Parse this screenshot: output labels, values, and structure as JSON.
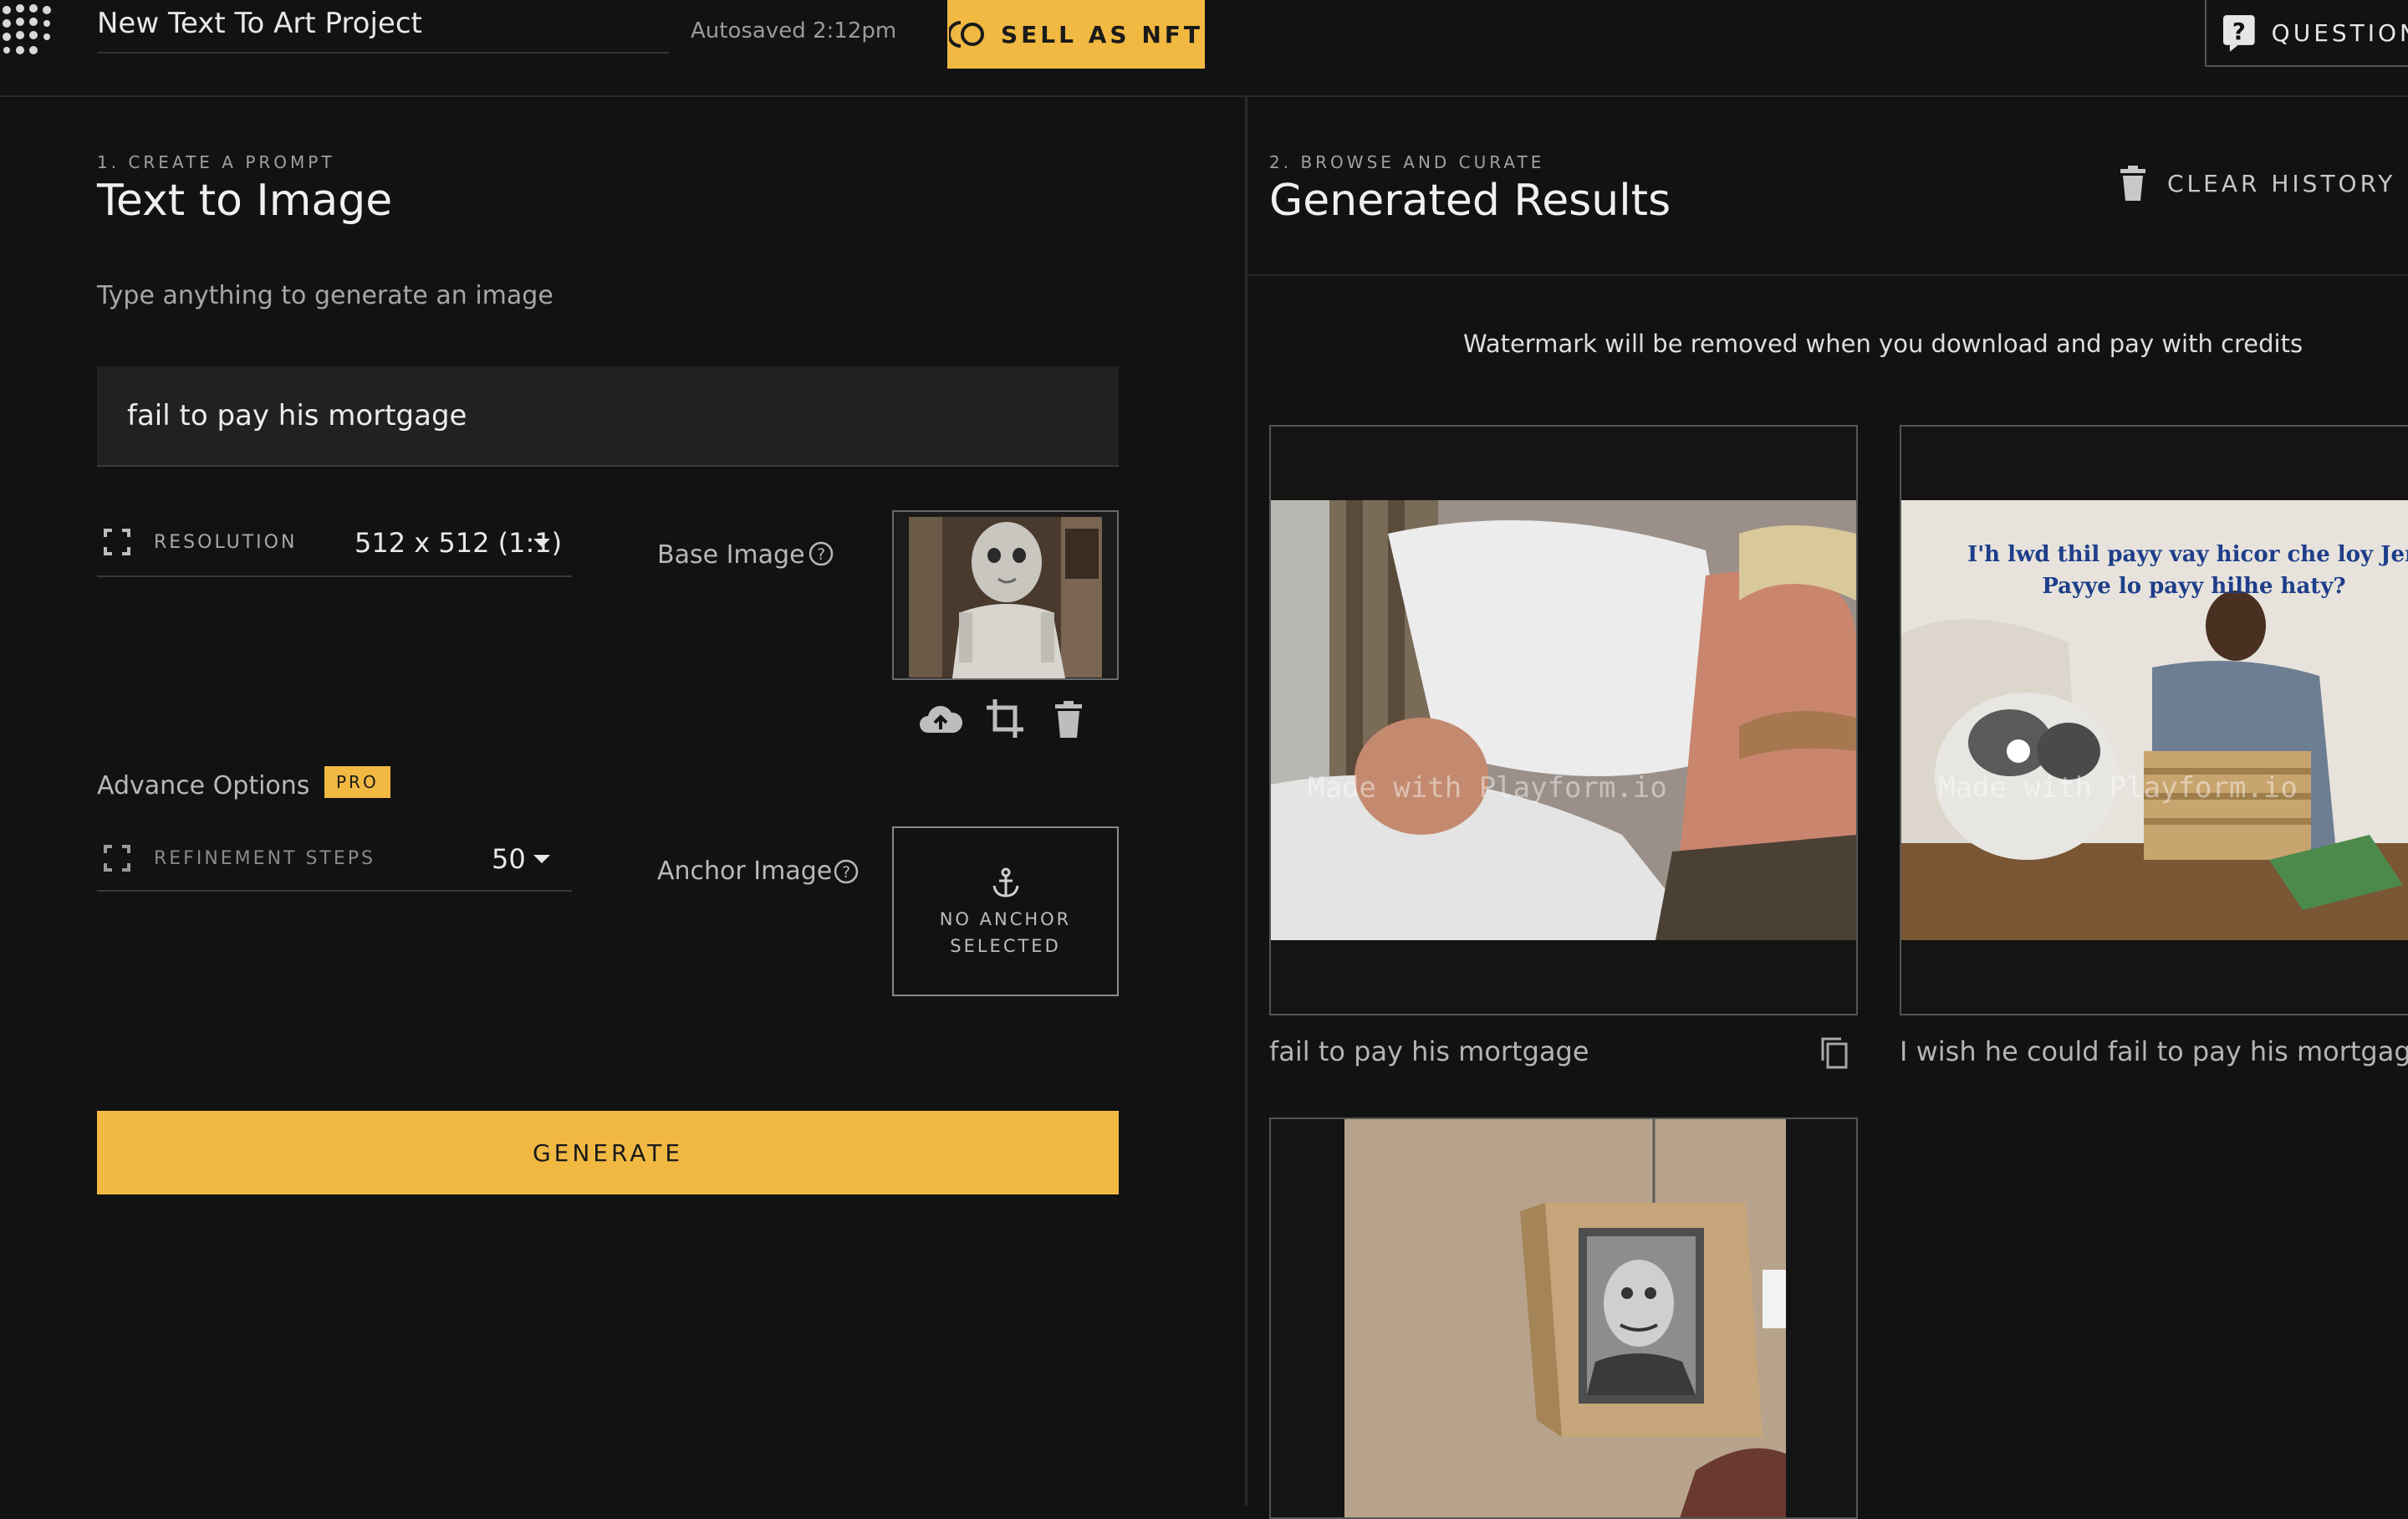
{
  "topbar": {
    "project_title": "New Text To Art Project",
    "autosave": "Autosaved 2:12pm",
    "sell_nft": "SELL AS NFT",
    "questions": "QUESTION"
  },
  "left": {
    "step": "1. CREATE A PROMPT",
    "title": "Text to Image",
    "hint": "Type anything to generate an image",
    "prompt_value": "fail to pay his mortgage",
    "resolution_label": "RESOLUTION",
    "resolution_value": "512 x 512 (1:1)",
    "base_image_label": "Base Image",
    "advance_label": "Advance Options",
    "pro_badge": "PRO",
    "refinement_label": "REFINEMENT STEPS",
    "refinement_value": "50",
    "anchor_label": "Anchor Image",
    "anchor_empty_line1": "NO ANCHOR",
    "anchor_empty_line2": "SELECTED",
    "generate": "GENERATE"
  },
  "right": {
    "step": "2. BROWSE AND CURATE",
    "title": "Generated Results",
    "clear_history": "CLEAR HISTORY",
    "watermark_notice": "Watermark will be removed when you download and pay with credits",
    "watermark_text": "Made with Playform.io",
    "results": [
      {
        "caption": "fail to pay his mortgage"
      },
      {
        "caption": "I wish he could fail to pay his mortgage",
        "image_text_line1": "I'h lwd thil payy vay hicor che loy Jen",
        "image_text_line2": "Payye lo payy hilhe haty?"
      },
      {
        "caption": ""
      }
    ]
  },
  "colors": {
    "accent": "#f1b942",
    "background": "#121212",
    "panel": "#1f1f1f"
  }
}
